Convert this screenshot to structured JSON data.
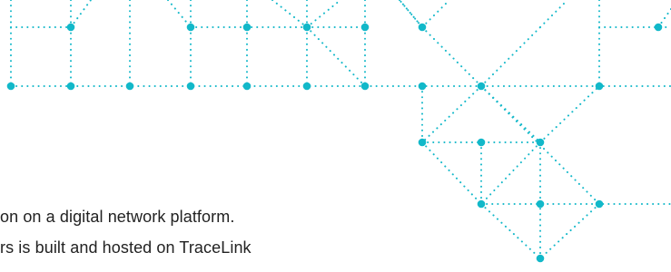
{
  "network_graphic": {
    "dot_color": "#12b8c9",
    "link_color": "#12b8c9"
  },
  "body_text": {
    "color": "#222222",
    "line_1": "on on a digital network platform.",
    "line_2": "rs is built and hosted on TraceLink"
  }
}
